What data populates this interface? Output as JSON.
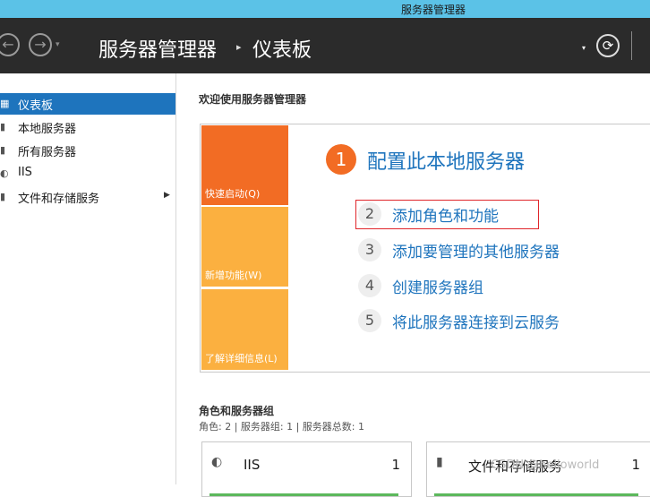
{
  "window": {
    "title": "服务器管理器"
  },
  "header": {
    "breadcrumb_root": "服务器管理器",
    "breadcrumb_sep": "▸",
    "breadcrumb_page": "仪表板",
    "back_glyph": "←",
    "forward_glyph": "→",
    "dropdown_glyph": "▾",
    "refresh_glyph": "⟳"
  },
  "sidebar": {
    "items": [
      {
        "label": "仪表板",
        "icon": "dashboard-icon",
        "glyph": "▦"
      },
      {
        "label": "本地服务器",
        "icon": "server-icon",
        "glyph": "▮"
      },
      {
        "label": "所有服务器",
        "icon": "servers-icon",
        "glyph": "▮"
      },
      {
        "label": "IIS",
        "icon": "iis-icon",
        "glyph": "◐"
      },
      {
        "label": "文件和存储服务",
        "icon": "file-storage-icon",
        "glyph": "▮",
        "arrow": "▶"
      }
    ]
  },
  "main": {
    "welcome_title": "欢迎使用服务器管理器",
    "tiles": [
      "快速启动(Q)",
      "新增功能(W)",
      "了解详细信息(L)"
    ],
    "step1": {
      "num": "1",
      "title": "配置此本地服务器"
    },
    "steps": [
      {
        "num": "2",
        "label": "添加角色和功能"
      },
      {
        "num": "3",
        "label": "添加要管理的其他服务器"
      },
      {
        "num": "4",
        "label": "创建服务器组"
      },
      {
        "num": "5",
        "label": "将此服务器连接到云服务"
      }
    ],
    "roles_title": "角色和服务器组",
    "roles_summary": "角色: 2 | 服务器组: 1 | 服务器总数: 1",
    "cards": [
      {
        "name": "IIS",
        "count": "1",
        "icon": "iis-icon",
        "glyph": "◐"
      },
      {
        "name": "文件和存储服务",
        "count": "1",
        "icon": "file-storage-icon",
        "glyph": "▮"
      }
    ]
  },
  "watermark": "CSDN @helloworld"
}
